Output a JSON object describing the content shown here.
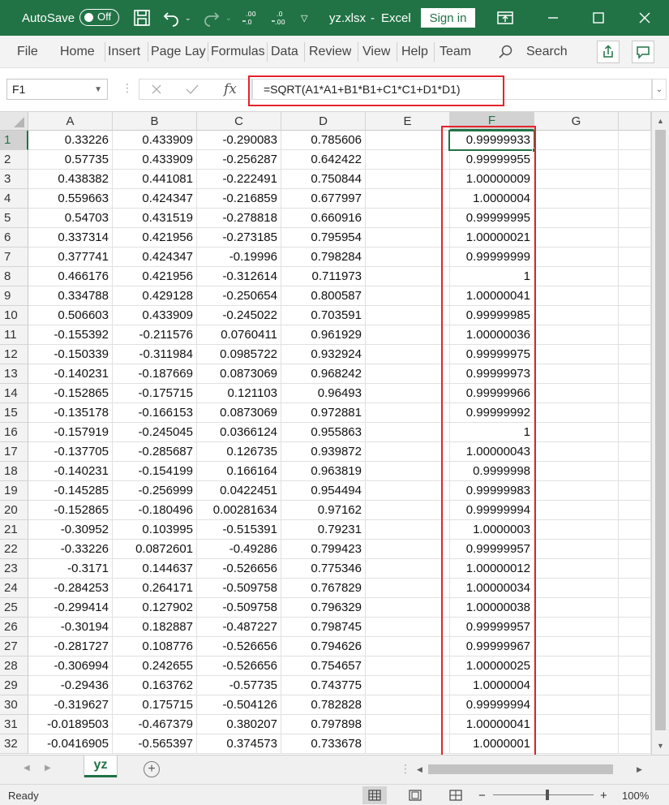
{
  "title_bar": {
    "autosave_label": "AutoSave",
    "autosave_state": "Off",
    "filename": "yz.xlsx",
    "separator": "-",
    "app_name": "Excel",
    "signin_label": "Sign in"
  },
  "ribbon": {
    "tabs": [
      "File",
      "Home",
      "Insert",
      "Page Layout",
      "Formulas",
      "Data",
      "Review",
      "View",
      "Help",
      "Team"
    ],
    "search_label": "Search"
  },
  "formula_bar": {
    "name_box": "F1",
    "fx_label": "fx",
    "formula": "=SQRT(A1*A1+B1*B1+C1*C1+D1*D1)"
  },
  "grid": {
    "columns": [
      "A",
      "B",
      "C",
      "D",
      "E",
      "F",
      "G"
    ],
    "selected_column": "F",
    "selected_row": "1",
    "rows": [
      {
        "n": "1",
        "cells": [
          "0.33226",
          "0.433909",
          "-0.290083",
          "0.785606",
          "",
          "0.99999933"
        ]
      },
      {
        "n": "2",
        "cells": [
          "0.57735",
          "0.433909",
          "-0.256287",
          "0.642422",
          "",
          "0.99999955"
        ]
      },
      {
        "n": "3",
        "cells": [
          "0.438382",
          "0.441081",
          "-0.222491",
          "0.750844",
          "",
          "1.00000009"
        ]
      },
      {
        "n": "4",
        "cells": [
          "0.559663",
          "0.424347",
          "-0.216859",
          "0.677997",
          "",
          "1.0000004"
        ]
      },
      {
        "n": "5",
        "cells": [
          "0.54703",
          "0.431519",
          "-0.278818",
          "0.660916",
          "",
          "0.99999995"
        ]
      },
      {
        "n": "6",
        "cells": [
          "0.337314",
          "0.421956",
          "-0.273185",
          "0.795954",
          "",
          "1.00000021"
        ]
      },
      {
        "n": "7",
        "cells": [
          "0.377741",
          "0.424347",
          "-0.19996",
          "0.798284",
          "",
          "0.99999999"
        ]
      },
      {
        "n": "8",
        "cells": [
          "0.466176",
          "0.421956",
          "-0.312614",
          "0.711973",
          "",
          "1"
        ]
      },
      {
        "n": "9",
        "cells": [
          "0.334788",
          "0.429128",
          "-0.250654",
          "0.800587",
          "",
          "1.00000041"
        ]
      },
      {
        "n": "10",
        "cells": [
          "0.506603",
          "0.433909",
          "-0.245022",
          "0.703591",
          "",
          "0.99999985"
        ]
      },
      {
        "n": "11",
        "cells": [
          "-0.155392",
          "-0.211576",
          "0.0760411",
          "0.961929",
          "",
          "1.00000036"
        ]
      },
      {
        "n": "12",
        "cells": [
          "-0.150339",
          "-0.311984",
          "0.0985722",
          "0.932924",
          "",
          "0.99999975"
        ]
      },
      {
        "n": "13",
        "cells": [
          "-0.140231",
          "-0.187669",
          "0.0873069",
          "0.968242",
          "",
          "0.99999973"
        ]
      },
      {
        "n": "14",
        "cells": [
          "-0.152865",
          "-0.175715",
          "0.121103",
          "0.96493",
          "",
          "0.99999966"
        ]
      },
      {
        "n": "15",
        "cells": [
          "-0.135178",
          "-0.166153",
          "0.0873069",
          "0.972881",
          "",
          "0.99999992"
        ]
      },
      {
        "n": "16",
        "cells": [
          "-0.157919",
          "-0.245045",
          "0.0366124",
          "0.955863",
          "",
          "1"
        ]
      },
      {
        "n": "17",
        "cells": [
          "-0.137705",
          "-0.285687",
          "0.126735",
          "0.939872",
          "",
          "1.00000043"
        ]
      },
      {
        "n": "18",
        "cells": [
          "-0.140231",
          "-0.154199",
          "0.166164",
          "0.963819",
          "",
          "0.9999998"
        ]
      },
      {
        "n": "19",
        "cells": [
          "-0.145285",
          "-0.256999",
          "0.0422451",
          "0.954494",
          "",
          "0.99999983"
        ]
      },
      {
        "n": "20",
        "cells": [
          "-0.152865",
          "-0.180496",
          "0.00281634",
          "0.97162",
          "",
          "0.99999994"
        ]
      },
      {
        "n": "21",
        "cells": [
          "-0.30952",
          "0.103995",
          "-0.515391",
          "0.79231",
          "",
          "1.0000003"
        ]
      },
      {
        "n": "22",
        "cells": [
          "-0.33226",
          "0.0872601",
          "-0.49286",
          "0.799423",
          "",
          "0.99999957"
        ]
      },
      {
        "n": "23",
        "cells": [
          "-0.3171",
          "0.144637",
          "-0.526656",
          "0.775346",
          "",
          "1.00000012"
        ]
      },
      {
        "n": "24",
        "cells": [
          "-0.284253",
          "0.264171",
          "-0.509758",
          "0.767829",
          "",
          "1.00000034"
        ]
      },
      {
        "n": "25",
        "cells": [
          "-0.299414",
          "0.127902",
          "-0.509758",
          "0.796329",
          "",
          "1.00000038"
        ]
      },
      {
        "n": "26",
        "cells": [
          "-0.30194",
          "0.182887",
          "-0.487227",
          "0.798745",
          "",
          "0.99999957"
        ]
      },
      {
        "n": "27",
        "cells": [
          "-0.281727",
          "0.108776",
          "-0.526656",
          "0.794626",
          "",
          "0.99999967"
        ]
      },
      {
        "n": "28",
        "cells": [
          "-0.306994",
          "0.242655",
          "-0.526656",
          "0.754657",
          "",
          "1.00000025"
        ]
      },
      {
        "n": "29",
        "cells": [
          "-0.29436",
          "0.163762",
          "-0.57735",
          "0.743775",
          "",
          "1.0000004"
        ]
      },
      {
        "n": "30",
        "cells": [
          "-0.319627",
          "0.175715",
          "-0.504126",
          "0.782828",
          "",
          "0.99999994"
        ]
      },
      {
        "n": "31",
        "cells": [
          "-0.0189503",
          "-0.467379",
          "0.380207",
          "0.797898",
          "",
          "1.00000041"
        ]
      },
      {
        "n": "32",
        "cells": [
          "-0.0416905",
          "-0.565397",
          "0.374573",
          "0.733678",
          "",
          "1.0000001"
        ]
      }
    ]
  },
  "sheet_tabs": {
    "active": "yz",
    "add_symbol": "+"
  },
  "status_bar": {
    "status": "Ready",
    "zoom_minus": "−",
    "zoom_plus": "+",
    "zoom": "100%"
  },
  "colors": {
    "brand": "#217346",
    "highlight": "#e3242b"
  }
}
